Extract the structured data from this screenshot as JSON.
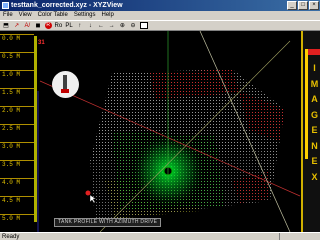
{
  "window": {
    "title": "testtank_corrected.xyz - XYZView"
  },
  "window_controls": {
    "minimize": "_",
    "maximize": "□",
    "close": "×"
  },
  "menu": [
    "File",
    "View",
    "Color Table",
    "Settings",
    "Help"
  ],
  "toolbar": {
    "buttons": [
      {
        "label": "⬒",
        "icon": "open-icon"
      },
      {
        "label": "↗",
        "icon": "pointer-icon"
      },
      {
        "label": "A/",
        "icon": "annotate-icon"
      },
      {
        "label": "◼",
        "icon": "save-icon"
      },
      {
        "label": "R",
        "icon": "record-icon"
      },
      {
        "label": "Ro",
        "icon": "rotate-icon"
      },
      {
        "label": "PL",
        "icon": "plane-icon"
      },
      {
        "label": "↑",
        "icon": "arrow-up-icon"
      },
      {
        "label": "↓",
        "icon": "arrow-down-icon"
      },
      {
        "label": "←",
        "icon": "arrow-left-icon"
      },
      {
        "label": "→",
        "icon": "arrow-right-icon"
      },
      {
        "label": "⊕",
        "icon": "zoom-in-icon"
      },
      {
        "label": "⊖",
        "icon": "zoom-out-icon"
      },
      {
        "label": "",
        "icon": "window-icon"
      }
    ]
  },
  "depth_scale": {
    "labels": [
      "0.0 M",
      "0.5 M",
      "1.0 M",
      "1.5 M",
      "2.0 M",
      "2.5 M",
      "3.0 M",
      "3.5 M",
      "4.0 M",
      "4.5 M",
      "5.0 M"
    ],
    "indicator_value": "31",
    "indicator_color": "#ff3030",
    "scale_color": "#e0c000"
  },
  "brand": {
    "logo": "IMAGENEX",
    "color": "#e8c000"
  },
  "caption": "TANK PROFILE WITH AZIMUTH DRIVE",
  "status": {
    "text": "Ready"
  }
}
